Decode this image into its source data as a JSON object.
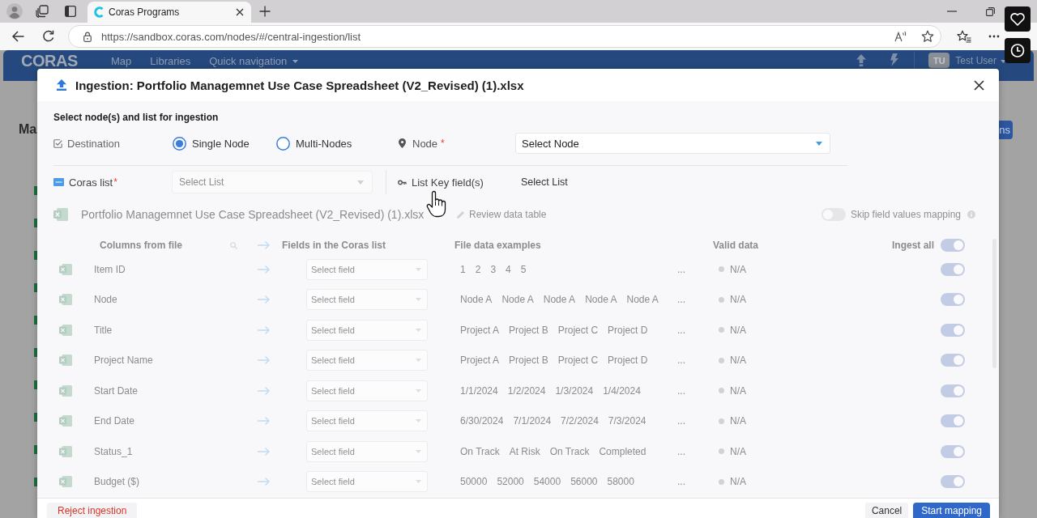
{
  "browser": {
    "tabs": [
      {
        "title": "Coras Programs",
        "selected": true
      }
    ],
    "url": "https://sandbox.coras.com/nodes/#/central-ingestion/list"
  },
  "app": {
    "logo": "CORAS",
    "nav": [
      {
        "label": "Map",
        "dropdown": false
      },
      {
        "label": "Libraries",
        "dropdown": false
      },
      {
        "label": "Quick navigation",
        "dropdown": true
      }
    ],
    "user": {
      "initials": "TU",
      "name": "Test User"
    },
    "page_heading": "Ma",
    "page_button": "ns"
  },
  "modal": {
    "title": "Ingestion: Portfolio Managemnet Use Case Spreadsheet (V2_Revised) (1).xlsx",
    "section_title": "Select node(s) and list for ingestion",
    "destination": {
      "label": "Destination",
      "options": [
        {
          "label": "Single Node",
          "selected": true
        },
        {
          "label": "Multi-Nodes",
          "selected": false
        }
      ]
    },
    "node": {
      "label": "Node",
      "required_mark": "*",
      "placeholder": "Select Node"
    },
    "coras_list": {
      "label": "Coras list",
      "required_mark": "*",
      "placeholder": "Select List",
      "disabled": true
    },
    "list_key": {
      "label": "List Key field(s)",
      "value": "Select List"
    },
    "mapping": {
      "disabled": true,
      "file_name": "Portfolio Managemnet Use Case Spreadsheet (V2_Revised) (1).xlsx",
      "review_link": "Review data table",
      "skip_mapping": {
        "label": "Skip field values mapping",
        "on": false
      },
      "columns": {
        "file": "Columns from file",
        "fields": "Fields in the Coras list",
        "examples": "File data examples",
        "valid": "Valid data"
      },
      "ingest_all": {
        "label": "Ingest all",
        "on": true
      },
      "rows": [
        {
          "name": "Item ID",
          "placeholder": "Select field",
          "examples": [
            "1",
            "2",
            "3",
            "4",
            "5"
          ],
          "more": "...",
          "valid": "N/A",
          "ingest": true
        },
        {
          "name": "Node",
          "placeholder": "Select field",
          "examples": [
            "Node A",
            "Node A",
            "Node A",
            "Node A",
            "Node A"
          ],
          "more": "...",
          "valid": "N/A",
          "ingest": true
        },
        {
          "name": "Title",
          "placeholder": "Select field",
          "examples": [
            "Project A",
            "Project B",
            "Project C",
            "Project D"
          ],
          "more": "...",
          "valid": "N/A",
          "ingest": true
        },
        {
          "name": "Project Name",
          "placeholder": "Select field",
          "examples": [
            "Project A",
            "Project B",
            "Project C",
            "Project D"
          ],
          "more": "...",
          "valid": "N/A",
          "ingest": true
        },
        {
          "name": "Start Date",
          "placeholder": "Select field",
          "examples": [
            "1/1/2024",
            "1/2/2024",
            "1/3/2024",
            "1/4/2024"
          ],
          "more": "...",
          "valid": "N/A",
          "ingest": true
        },
        {
          "name": "End Date",
          "placeholder": "Select field",
          "examples": [
            "6/30/2024",
            "7/1/2024",
            "7/2/2024",
            "7/3/2024"
          ],
          "more": "...",
          "valid": "N/A",
          "ingest": true
        },
        {
          "name": "Status_1",
          "placeholder": "Select field",
          "examples": [
            "On Track",
            "At Risk",
            "On Track",
            "Completed"
          ],
          "more": "...",
          "valid": "N/A",
          "ingest": true
        },
        {
          "name": "Budget ($)",
          "placeholder": "Select field",
          "examples": [
            "50000",
            "52000",
            "54000",
            "56000",
            "58000"
          ],
          "more": "...",
          "valid": "N/A",
          "ingest": true
        }
      ]
    },
    "footer": {
      "reject": "Reject ingestion",
      "cancel": "Cancel",
      "start": "Start mapping"
    }
  }
}
